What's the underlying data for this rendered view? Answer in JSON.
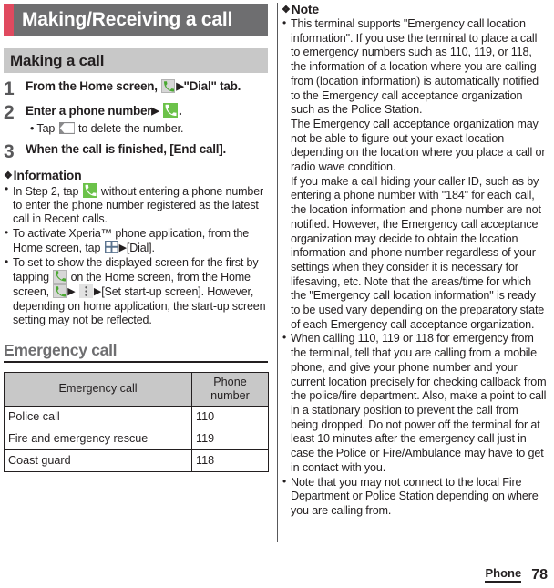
{
  "chapter": {
    "title": "Making/Receiving a call",
    "accent_color": "#e04a5f",
    "bar_color": "#6e6e70"
  },
  "section": {
    "title": "Making a call",
    "band_color": "#c8c8c8"
  },
  "steps": [
    {
      "number": "1",
      "text_before": "From the Home screen,",
      "icon1": "phone-icon",
      "arrow": "▶",
      "text_after": "\"Dial\" tab.",
      "sub": null
    },
    {
      "number": "2",
      "text_before": "Enter a phone number",
      "arrow": "▶",
      "icon1": "phone-green-icon",
      "text_after": ".",
      "sub_before": "• Tap",
      "sub_icon": "delete-backspace-icon",
      "sub_after": "to delete the number."
    },
    {
      "number": "3",
      "text_before": "When the call is finished, [End call].",
      "sub": null
    }
  ],
  "information": {
    "heading": "Information",
    "diamond": "❖",
    "bullets": [
      {
        "part1": "In Step 2, tap",
        "icon": "phone-green-icon",
        "part2": "without entering a phone number to enter the phone number registered as the latest call in Recent calls."
      },
      {
        "part1": "To activate Xperia™ phone application, from the Home screen, tap",
        "icon": "app-grid-icon",
        "arrow": "▶",
        "part2": "[Dial]."
      },
      {
        "part1": "To set to show the displayed screen for the first by tapping",
        "icon": "phone-icon",
        "part2": "on the Home screen, from the Home screen,",
        "icon2": "phone-icon",
        "arrow1": "▶",
        "icon3": "overflow-menu-icon",
        "arrow2": "▶",
        "part3": "[Set start-up screen]. However, depending on home application, the start-up screen setting may not be reflected."
      }
    ]
  },
  "emergency": {
    "heading": "Emergency call",
    "table": {
      "columns": [
        "Emergency call",
        "Phone number"
      ],
      "rows": [
        {
          "name": "Police call",
          "number": "110"
        },
        {
          "name": "Fire and emergency rescue",
          "number": "119"
        },
        {
          "name": "Coast guard",
          "number": "118"
        }
      ]
    }
  },
  "note": {
    "heading": "Note",
    "diamond": "❖",
    "bullets": [
      {
        "paragraphs": [
          "This terminal supports \"Emergency call location information\". If you use the terminal to place a call to emergency numbers such as 110, 119, or 118, the information of a location where you are calling from (location information) is automatically notified to the Emergency call acceptance organization such as the Police Station.",
          "The Emergency call acceptance organization may not be able to figure out your exact location depending on the location where you place a call or radio wave condition.",
          "If you make a call hiding your caller ID, such as by entering a phone number with \"184\" for each call, the location information and phone number are not notified. However, the Emergency call acceptance organization may decide to obtain the location information and phone number regardless of your settings when they consider it is necessary for lifesaving, etc. Note that the areas/time for which the \"Emergency call location information\" is ready to be used vary depending on the preparatory state of each Emergency call acceptance organization."
        ]
      },
      {
        "paragraphs": [
          "When calling 110, 119 or 118 for emergency from the terminal, tell that you are calling from a mobile phone, and give your phone number and your current location precisely for checking callback from the police/fire department. Also, make a point to call in a stationary position to prevent the call from being dropped. Do not power off the terminal for at least 10 minutes after the emergency call just in case the Police or Fire/Ambulance may have to get in contact with you."
        ]
      },
      {
        "paragraphs": [
          "Note that you may not connect to the local Fire Department or Police Station depending on where you are calling from."
        ]
      }
    ]
  },
  "footer": {
    "tab_label": "Phone",
    "page_number": "78"
  }
}
